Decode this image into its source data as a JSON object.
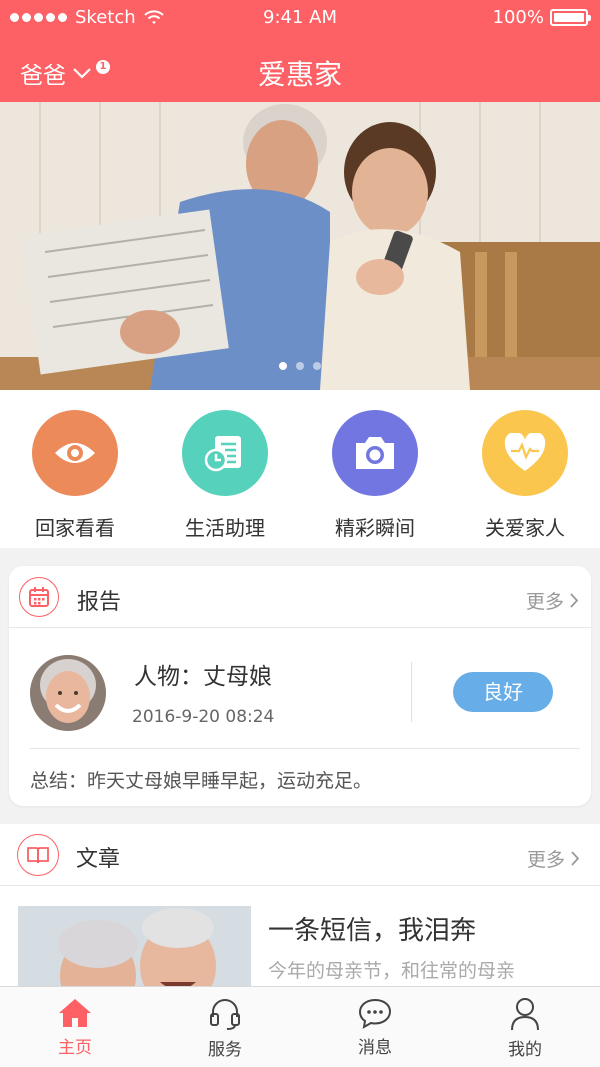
{
  "status_bar": {
    "carrier": "Sketch",
    "time": "9:41 AM",
    "battery": "100%"
  },
  "nav": {
    "user": "爸爸",
    "badge": "1",
    "title": "爱惠家"
  },
  "banner": {
    "page_count": 3,
    "active_page": 1
  },
  "shortcuts": [
    {
      "label": "回家看看",
      "icon": "eye-icon",
      "color": "#ec8a5a"
    },
    {
      "label": "生活助理",
      "icon": "schedule-list-icon",
      "color": "#56d1bc"
    },
    {
      "label": "精彩瞬间",
      "icon": "camera-icon",
      "color": "#7276e0"
    },
    {
      "label": "关爱家人",
      "icon": "heart-pulse-icon",
      "color": "#fac64e"
    }
  ],
  "report": {
    "title": "报告",
    "more": "更多",
    "person": "人物：丈母娘",
    "time": "2016-9-20 08:24",
    "status": "良好",
    "summary": "总结：昨天丈母娘早睡早起，运动充足。"
  },
  "articles": {
    "title": "文章",
    "more": "更多",
    "item": {
      "title": "一条短信，我泪奔",
      "excerpt": "今年的母亲节，和往常的母亲"
    }
  },
  "tabs": [
    {
      "label": "主页",
      "icon": "home-icon",
      "active": true
    },
    {
      "label": "服务",
      "icon": "headset-icon",
      "active": false
    },
    {
      "label": "消息",
      "icon": "chat-bubble-icon",
      "active": false
    },
    {
      "label": "我的",
      "icon": "person-icon",
      "active": false
    }
  ],
  "colors": {
    "brand": "#fd6065",
    "good": "#67aee9"
  }
}
